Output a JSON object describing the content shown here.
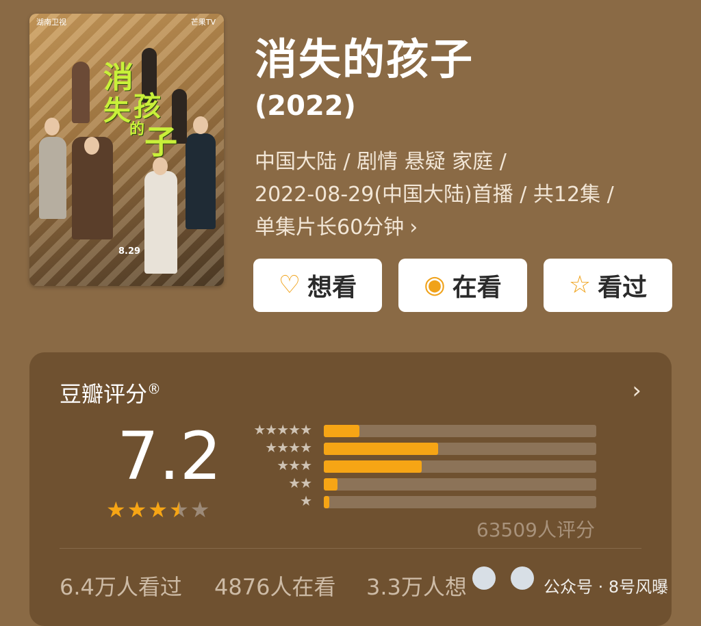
{
  "poster": {
    "title_chars": [
      "消",
      "失",
      "的",
      "孩",
      "子"
    ],
    "date": "8.29",
    "channel_logo": "湖南卫视",
    "platform_logo": "芒果TV"
  },
  "title": "消失的孩子",
  "year": "(2022)",
  "meta": {
    "line1": "中国大陆 / 剧情 悬疑 家庭 /",
    "line2": "2022-08-29(中国大陆)首播 / 共12集 /",
    "line3": "单集片长60分钟",
    "more_icon": "chevron-right-icon"
  },
  "actions": {
    "want": {
      "label": "想看",
      "icon": "heart-plus-icon"
    },
    "watching": {
      "label": "在看",
      "icon": "circle-dot-icon"
    },
    "watched": {
      "label": "看过",
      "icon": "star-outline-icon"
    }
  },
  "rating": {
    "title": "豆瓣评分",
    "registered": "®",
    "score": "7.2",
    "stars": 3.5,
    "distribution": [
      {
        "stars": 5,
        "fraction": 0.13
      },
      {
        "stars": 4,
        "fraction": 0.42
      },
      {
        "stars": 3,
        "fraction": 0.36
      },
      {
        "stars": 2,
        "fraction": 0.05
      },
      {
        "stars": 1,
        "fraction": 0.02
      }
    ],
    "count_text": "63509人评分",
    "stats": {
      "watched": "6.4万人看过",
      "watching": "4876人在看",
      "want": "3.3万人想"
    }
  },
  "watermark": "公众号 · 8号风曝",
  "colors": {
    "accent": "#f6a515",
    "background": "#8a6a45",
    "card": "#6f5130"
  }
}
